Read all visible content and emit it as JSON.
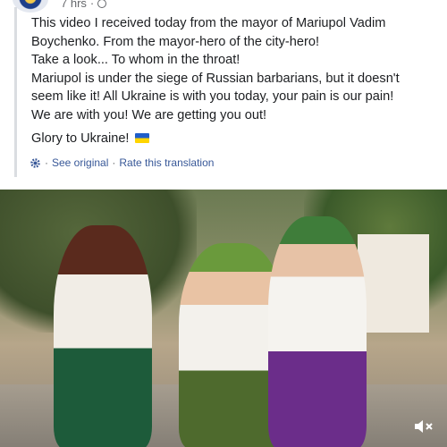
{
  "post": {
    "time": "7 hrs",
    "paragraph1": "This video I received today from the mayor of Mariupol Vadim\nBoychenko. From the mayor-hero of the city-hero!\nTake a look... To whom in the throat!\nMariupol is under the siege of Russian barbarians, but it doesn't\nseem like it! All Ukraine is with you today, your pain is our pain!\nWe are with you! We are getting you out!",
    "paragraph2": "Glory to Ukraine!"
  },
  "translation": {
    "see_original": "See original",
    "rate": "Rate this translation",
    "separator": "·"
  },
  "icons": {
    "globe": "globe-icon",
    "gear": "gear-icon",
    "flag": "ukraine-flag-icon",
    "volume": "volume-muted-icon"
  },
  "colors": {
    "link": "#385898",
    "secondary_text": "#65676b",
    "flag_blue": "#1f5ec9",
    "flag_yellow": "#ffd500"
  }
}
